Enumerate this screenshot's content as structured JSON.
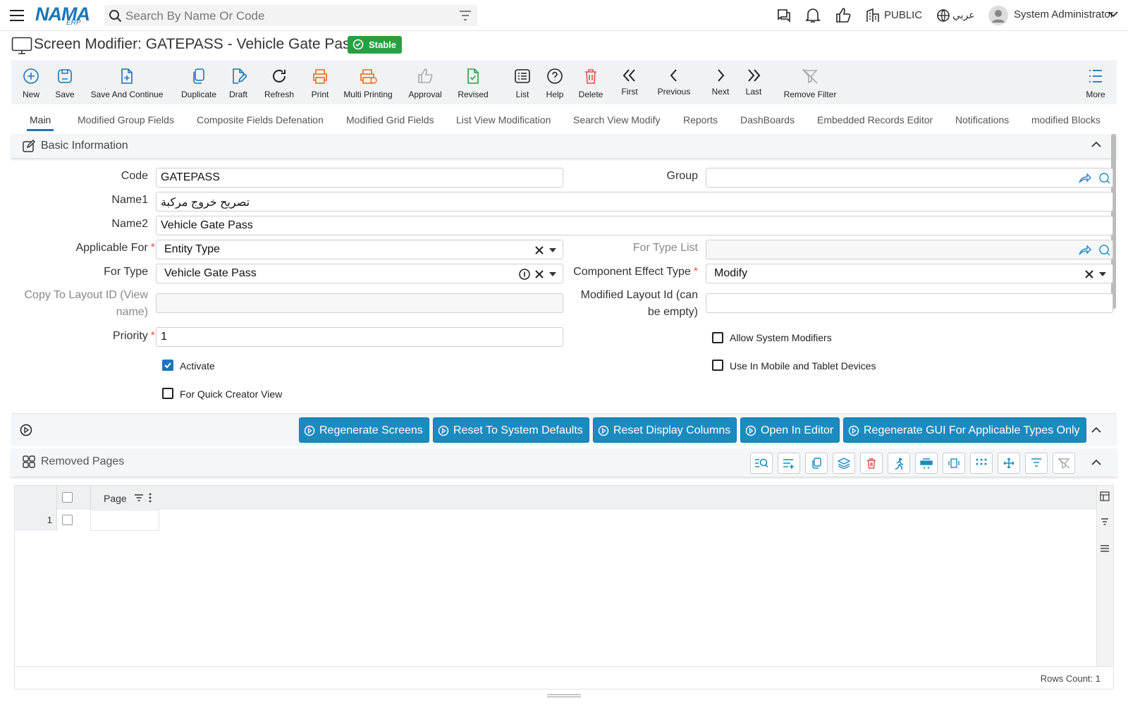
{
  "app": {
    "logo": "NAMA",
    "logo_sub": "ERP"
  },
  "search": {
    "placeholder": "Search By Name Or Code"
  },
  "header": {
    "branch": "PUBLIC",
    "language": "عربي",
    "user": "System Administrator"
  },
  "page": {
    "title": "Screen Modifier: GATEPASS - Vehicle Gate Pass",
    "status": "Stable",
    "status_color": "#27a043"
  },
  "toolbar": {
    "new": "New",
    "save": "Save",
    "save_continue": "Save And Continue",
    "duplicate": "Duplicate",
    "draft": "Draft",
    "refresh": "Refresh",
    "print": "Print",
    "multi_printing": "Multi Printing",
    "approval": "Approval",
    "revised": "Revised",
    "list": "List",
    "help": "Help",
    "delete": "Delete",
    "first": "First",
    "previous": "Previous",
    "next": "Next",
    "last": "Last",
    "remove_filter": "Remove Filter",
    "more": "More"
  },
  "tabs": [
    "Main",
    "Modified Group Fields",
    "Composite Fields Defenation",
    "Modified Grid Fields",
    "List View Modification",
    "Search View Modify",
    "Reports",
    "DashBoards",
    "Embedded Records Editor",
    "Notifications",
    "modified Blocks"
  ],
  "basic": {
    "title": "Basic Information",
    "code_label": "Code",
    "code_value": "GATEPASS",
    "group_label": "Group",
    "group_value": "",
    "name1_label": "Name1",
    "name1_value": "تصريح خروج مركبة",
    "name2_label": "Name2",
    "name2_value": "Vehicle Gate Pass",
    "applicable_label": "Applicable For",
    "applicable_value": "Entity Type",
    "fortypelist_label": "For Type List",
    "fortypelist_value": "",
    "fortype_label": "For Type",
    "fortype_value": "Vehicle Gate Pass",
    "effect_label": "Component Effect Type",
    "effect_value": "Modify",
    "copy_label_1": "Copy To Layout ID (View",
    "copy_label_2": "name)",
    "modlayout_label_1": "Modified Layout Id (can",
    "modlayout_label_2": "be empty)",
    "priority_label": "Priority",
    "priority_value": "1",
    "allow_sys": "Allow System Modifiers",
    "activate": "Activate",
    "mobile": "Use In Mobile and Tablet Devices",
    "quick": "For Quick Creator View",
    "required_mark": "*"
  },
  "actions": [
    "Regenerate Screens",
    "Reset To System Defaults",
    "Reset Display Columns",
    "Open In Editor",
    "Regenerate GUI For Applicable Types Only"
  ],
  "removed": {
    "title": "Removed Pages",
    "column": "Page",
    "row_number": "1",
    "rows_count": "Rows Count: 1"
  },
  "colors": {
    "accent": "#1976b8",
    "button": "#1b8bbf",
    "print": "#e8691f",
    "revised": "#27a043",
    "delete": "#d9534f"
  }
}
